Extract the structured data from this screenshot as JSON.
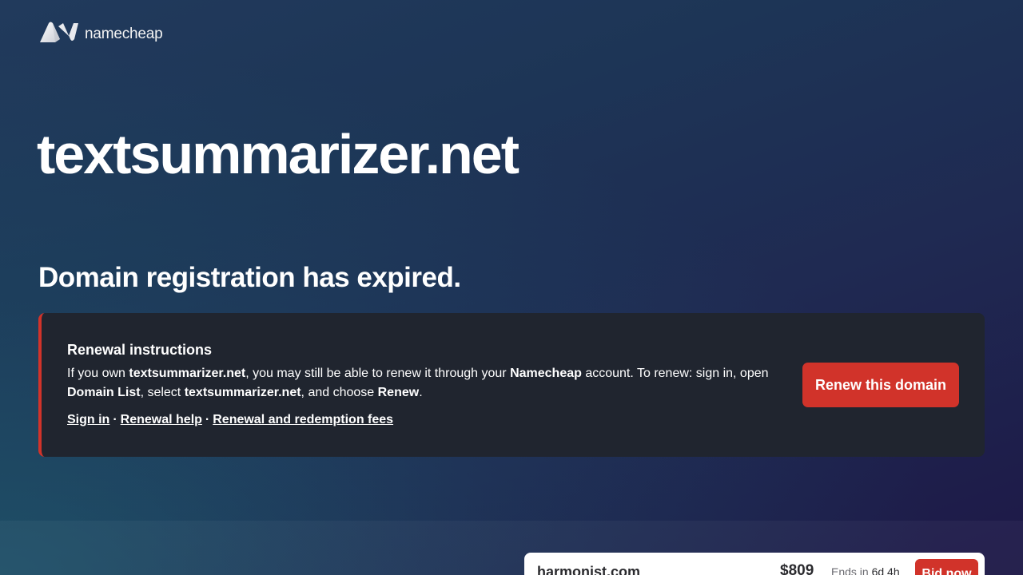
{
  "brand": {
    "name": "namecheap",
    "logo_icon": "namecheap-n-logo"
  },
  "domain": "textsummarizer.net",
  "status_heading": "Domain registration has expired.",
  "renewal": {
    "title": "Renewal instructions",
    "text": {
      "p1": "If you own ",
      "domain1": "textsummarizer.net",
      "p2": ", you may still be able to renew it through your ",
      "brand": "Namecheap",
      "p3": " account. To renew: sign in, open ",
      "domain_list": "Domain List",
      "p4": ", select ",
      "domain2": "textsummarizer.net",
      "p5": ", and choose ",
      "renew": "Renew",
      "p6": "."
    },
    "links": {
      "sign_in": "Sign in",
      "separator": "·",
      "renewal_help": "Renewal help",
      "fees": "Renewal and redemption fees"
    },
    "button_label": "Renew this domain"
  },
  "listing": {
    "name": "harmonist.com",
    "price": "$809",
    "ends_label": "Ends in",
    "ends_value": "6d 4h",
    "bid_label": "Bid now"
  },
  "colors": {
    "accent": "#d1332a",
    "card_bg": "#20252f"
  }
}
